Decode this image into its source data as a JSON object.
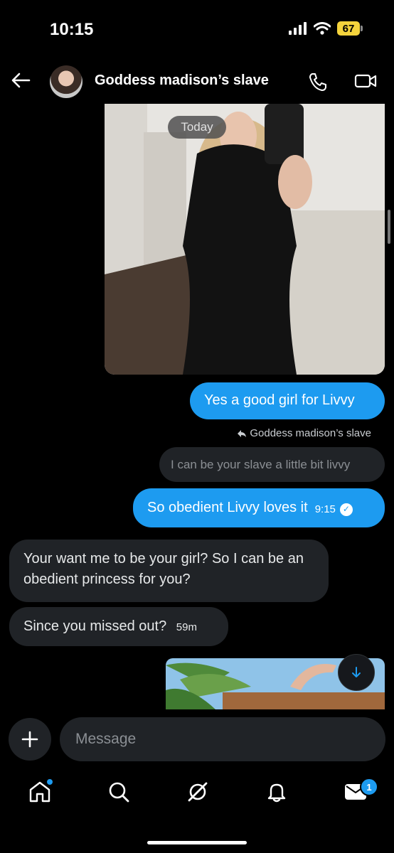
{
  "status_bar": {
    "time": "10:15",
    "battery": "67"
  },
  "header": {
    "title": "Goddess madison’s slave"
  },
  "date_pill": "Today",
  "messages": {
    "out_1": "Yes a good girl for Livvy",
    "reply_to_label": "Goddess madison’s slave",
    "quoted": "I can be your slave a little  bit livvy",
    "out_2": "So obedient Livvy loves it",
    "out_2_time": "9:15",
    "in_1": "Your want me to be your girl? So I can be an obedient princess for you?",
    "in_2": "Since you missed out?",
    "in_2_time": "59m"
  },
  "composer": {
    "placeholder": "Message"
  },
  "tabs": {
    "messages_badge": "1"
  },
  "colors": {
    "accent": "#1d9bf0",
    "incoming_bubble": "#202327",
    "background": "#000000"
  },
  "icons": [
    "back-arrow-icon",
    "phone-icon",
    "video-call-icon",
    "arrow-down-icon",
    "plus-icon",
    "home-icon",
    "search-icon",
    "grok-icon",
    "bell-icon",
    "mail-icon"
  ]
}
